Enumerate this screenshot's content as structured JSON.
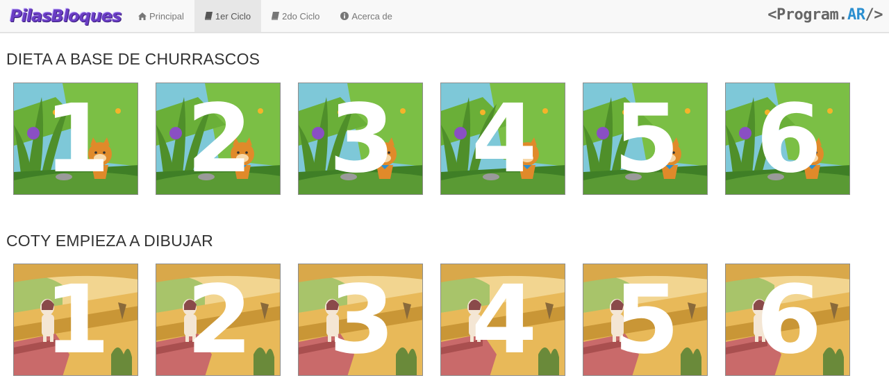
{
  "nav": {
    "brand": "PilasBloques",
    "items": [
      {
        "label": "Principal",
        "icon": "home-icon"
      },
      {
        "label": "1er Ciclo",
        "icon": "book-icon"
      },
      {
        "label": "2do Ciclo",
        "icon": "book-icon"
      },
      {
        "label": "Acerca de",
        "icon": "info-icon"
      }
    ],
    "active_index": 1,
    "logo": {
      "prefix": "<Program.",
      "accent": "AR",
      "suffix": "/>"
    }
  },
  "sections": [
    {
      "title": "DIETA A BASE DE CHURRASCOS",
      "scene": "jungle-cat",
      "tiles": [
        "1",
        "2",
        "3",
        "4",
        "5",
        "6"
      ]
    },
    {
      "title": "COTY EMPIEZA A DIBUJAR",
      "scene": "desert-llama",
      "tiles": [
        "1",
        "2",
        "3",
        "4",
        "5",
        "6"
      ]
    }
  ],
  "colors": {
    "navbar_bg": "#f8f8f8",
    "nav_active_bg": "#e7e7e7",
    "brand_purple": "#6a3dc4",
    "logo_accent": "#2b8fd0",
    "jungle_green": "#5a9a34",
    "desert_sand": "#e8b959"
  }
}
